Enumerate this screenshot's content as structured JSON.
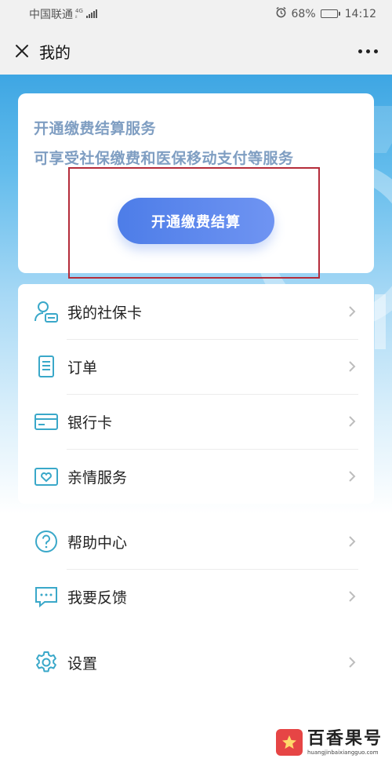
{
  "status_bar": {
    "carrier": "中国联通",
    "network_top": "4G",
    "network_bottom": "ᵢₗ",
    "battery_percent": "68%",
    "battery_level": 0.68,
    "time": "14:12"
  },
  "nav": {
    "title": "我的"
  },
  "service_card": {
    "line1": "开通缴费结算服务",
    "line2": "可享受社保缴费和医保移动支付等服务",
    "button_label": "开通缴费结算"
  },
  "menu_group_1": [
    {
      "label": "我的社保卡",
      "icon": "social-security-card-icon"
    },
    {
      "label": "订单",
      "icon": "order-icon"
    },
    {
      "label": "银行卡",
      "icon": "bank-card-icon"
    },
    {
      "label": "亲情服务",
      "icon": "family-service-icon"
    }
  ],
  "menu_group_2": [
    {
      "label": "帮助中心",
      "icon": "help-icon"
    },
    {
      "label": "我要反馈",
      "icon": "feedback-icon"
    }
  ],
  "menu_group_3": [
    {
      "label": "设置",
      "icon": "settings-icon"
    }
  ],
  "watermark": {
    "name": "百香果号",
    "url": "huangjinbaixiangguo.com"
  },
  "colors": {
    "accent_blue": "#4d7de8",
    "icon_teal": "#3aa8c9",
    "service_text": "#7f9ec2",
    "highlight_red": "#b52c3a"
  }
}
